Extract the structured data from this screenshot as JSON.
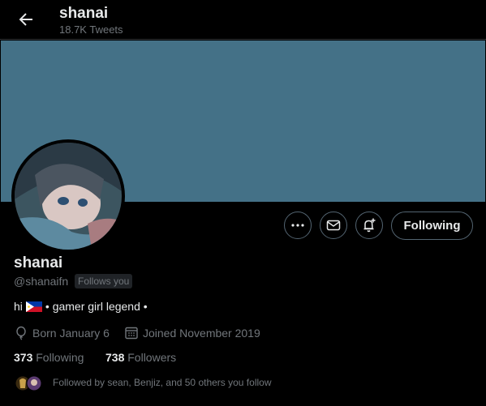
{
  "header": {
    "name": "shanai",
    "tweets_count": "18.7K Tweets",
    "back_icon": "arrow-left-icon"
  },
  "colors": {
    "banner": "#447187",
    "background": "#000000",
    "secondary_text": "#71767b"
  },
  "profile": {
    "name": "shanai",
    "handle": "@shanaifn",
    "follows_you": "Follows you",
    "bio": {
      "prefix": "hi",
      "flag": "philippines-flag",
      "text": "• gamer girl legend •"
    },
    "born": "Born January 6",
    "joined": "Joined November 2019",
    "following_count": "373",
    "following_label": "Following",
    "followers_count": "738",
    "followers_label": "Followers",
    "followed_by": "Followed by sean, Benjiz, and 50 others you follow"
  },
  "actions": {
    "follow_button": "Following",
    "more_icon": "more-icon",
    "message_icon": "envelope-icon",
    "notify_icon": "bell-plus-icon"
  }
}
